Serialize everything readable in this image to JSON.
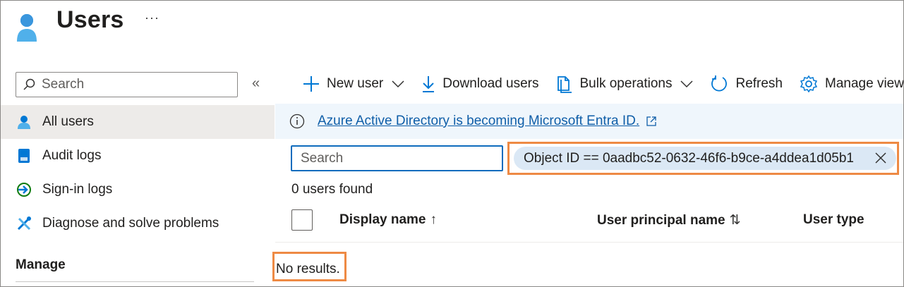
{
  "header": {
    "title": "Users",
    "more_label": "···",
    "icon": "user-icon"
  },
  "nav": {
    "search_placeholder": "Search",
    "collapse_label": "«",
    "items": [
      {
        "label": "All users",
        "icon": "user-icon",
        "active": true
      },
      {
        "label": "Audit logs",
        "icon": "audit-log-icon"
      },
      {
        "label": "Sign-in logs",
        "icon": "sign-in-icon"
      },
      {
        "label": "Diagnose and solve problems",
        "icon": "wrench-icon"
      }
    ],
    "section_label": "Manage"
  },
  "toolbar": {
    "new_user": "New user",
    "download_users": "Download users",
    "bulk_operations": "Bulk operations",
    "refresh": "Refresh",
    "manage_view": "Manage view"
  },
  "banner": {
    "link_text": "Azure Active Directory is becoming Microsoft Entra ID."
  },
  "filter": {
    "search_placeholder": "Search",
    "pill_text": "Object ID == 0aadbc52-0632-46f6-b9ce-a4ddea1d05b1"
  },
  "results": {
    "count_text": "0 users found",
    "columns": [
      {
        "label": "Display name",
        "sort": "↑"
      },
      {
        "label": "User principal name",
        "sort": "⇅"
      },
      {
        "label": "User type",
        "sort": ""
      }
    ],
    "empty_text": "No results."
  },
  "colors": {
    "accent": "#0f6cbd",
    "highlight": "#ee8a44",
    "banner_bg": "#eff6fc",
    "pill_bg": "#dbe8f5"
  }
}
